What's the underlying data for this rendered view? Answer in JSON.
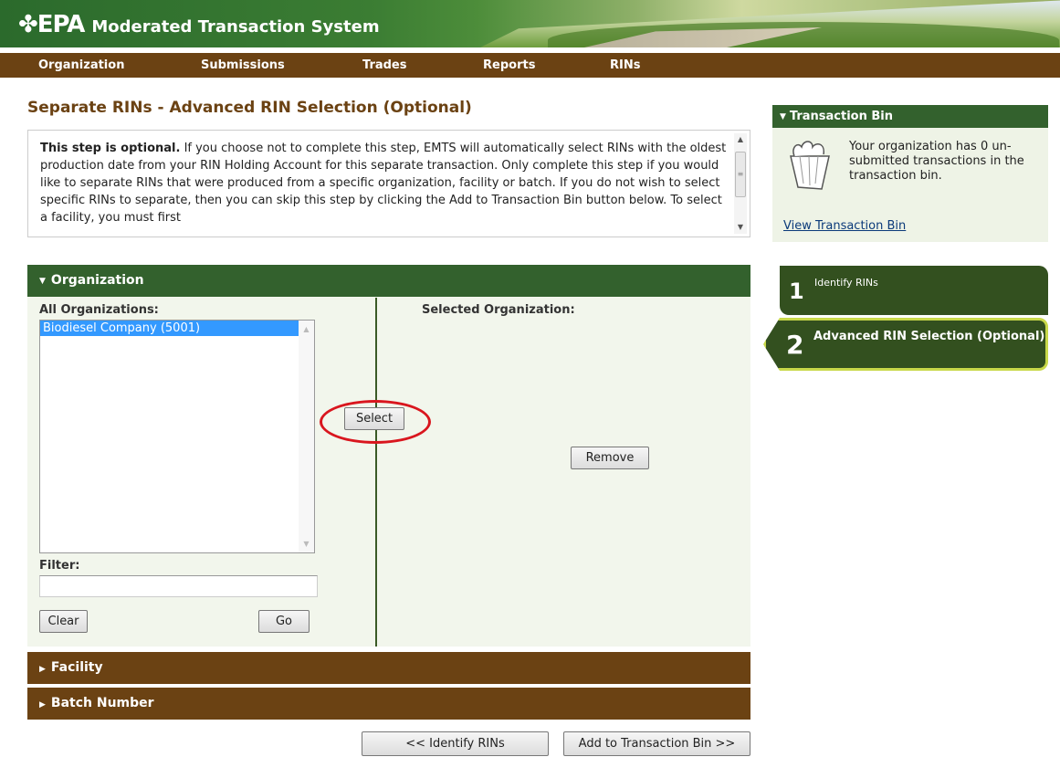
{
  "header": {
    "logo_mark": "✤EPA",
    "app_title": "Moderated Transaction System",
    "nav": [
      "Organization",
      "Submissions",
      "Trades",
      "Reports",
      "RINs"
    ]
  },
  "page_title": "Separate RINs - Advanced RIN Selection (Optional)",
  "info": {
    "bold_lead": "This step is optional.",
    "body": " If you choose not to complete this step, EMTS will automatically select RINs with the oldest production date from your RIN Holding Account for this separate transaction. Only complete this step if you would like to separate RINs that were produced from a specific organization, facility or batch. If you do not wish to select specific RINs to separate, then you can skip this step by clicking the Add to Transaction Bin button below. To select a facility, you must first"
  },
  "organization": {
    "header": "Organization",
    "all_label": "All Organizations:",
    "selected_label": "Selected Organization:",
    "options": [
      "Biodiesel Company (5001)"
    ],
    "filter_label": "Filter:",
    "filter_value": "",
    "clear_label": "Clear",
    "go_label": "Go",
    "select_label": "Select",
    "remove_label": "Remove"
  },
  "facility": {
    "header": "Facility"
  },
  "batch": {
    "header": "Batch Number"
  },
  "footer_buttons": {
    "back": "<< Identify RINs",
    "add": "Add to Transaction Bin >>"
  },
  "transaction_bin": {
    "header": "Transaction Bin",
    "message": "Your organization has 0 un-submitted transactions in the transaction bin.",
    "link": "View Transaction Bin"
  },
  "steps": [
    {
      "num": "1",
      "label": "Identify RINs"
    },
    {
      "num": "2",
      "label": "Advanced RIN Selection (Optional)"
    }
  ],
  "colors": {
    "brand_green": "#33612d",
    "brand_brown": "#6b4213",
    "highlight_ring": "#d9161e",
    "step_accent": "#c8d84a"
  }
}
